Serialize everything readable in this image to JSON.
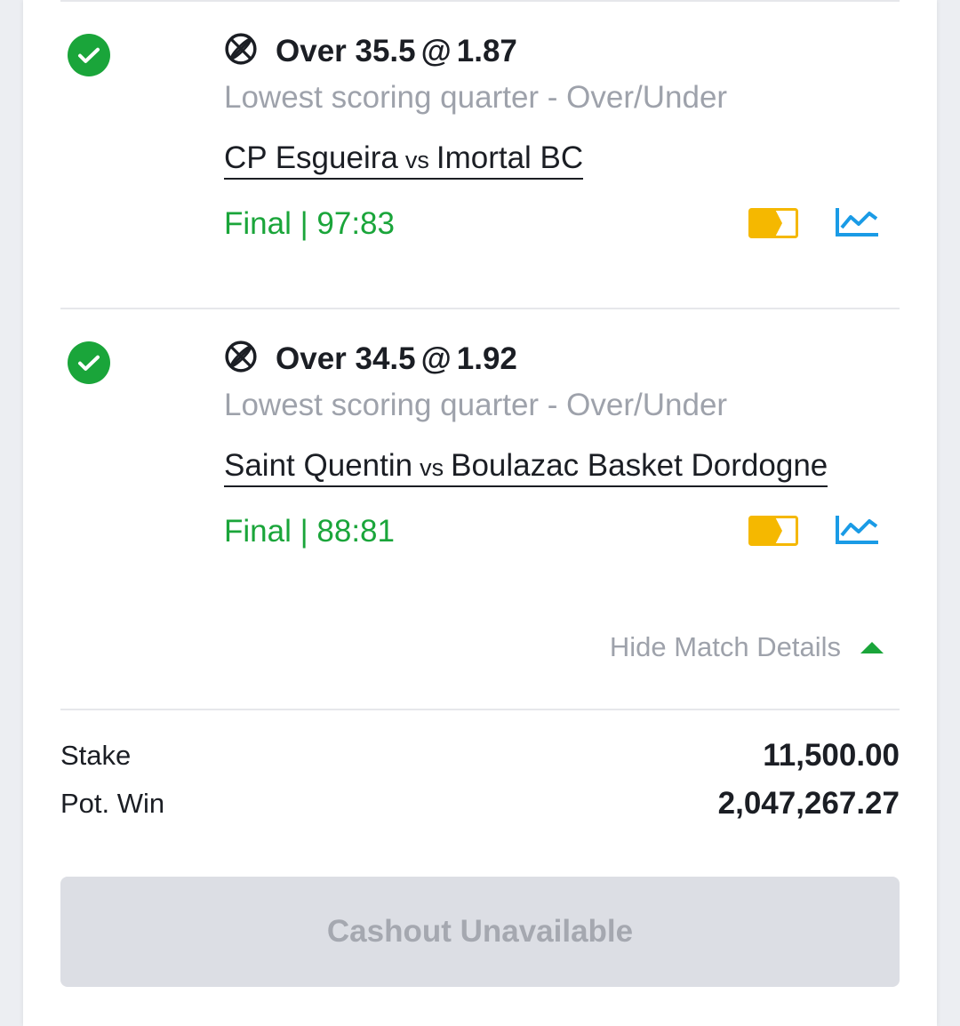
{
  "bets": [
    {
      "status_icon": "check-circle-icon",
      "sport_icon": "basketball-icon",
      "selection": "Over 35.5",
      "at": "@",
      "odds": "1.87",
      "market": "Lowest scoring quarter - Over/Under",
      "home": "CP Esgueira",
      "vs": "vs",
      "away": "Imortal BC",
      "result": "Final | 97:83"
    },
    {
      "status_icon": "check-circle-icon",
      "sport_icon": "basketball-icon",
      "selection": "Over 34.5",
      "at": "@",
      "odds": "1.92",
      "market": "Lowest scoring quarter - Over/Under",
      "home": "Saint Quentin",
      "vs": "vs",
      "away": "Boulazac Basket Dordogne",
      "result": "Final | 88:81"
    }
  ],
  "toggle_label": "Hide Match Details",
  "summary": {
    "stake_label": "Stake",
    "stake_value": "11,500.00",
    "potwin_label": "Pot. Win",
    "potwin_value": "2,047,267.27"
  },
  "cashout_label": "Cashout Unavailable",
  "colors": {
    "accent_green": "#1aa53a",
    "tv_yellow": "#f5b800",
    "stats_blue": "#1a9be6"
  }
}
